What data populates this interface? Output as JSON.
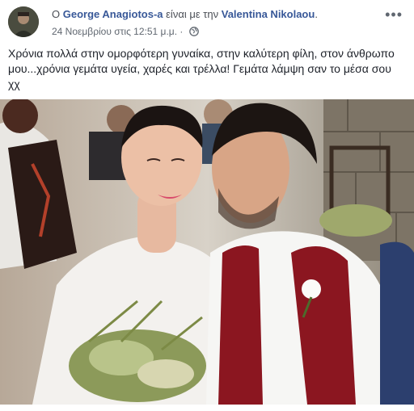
{
  "post": {
    "prefix": "O",
    "author": "George Anagiotos-a",
    "with_text": "είναι με την",
    "tagged": "Valentina Nikolaou",
    "tagged_suffix": ".",
    "timestamp": "24 Νοεμβρίου στις 12:51 μ.μ.",
    "privacy_dot": "·",
    "more_label": "•••",
    "body": "Χρόνια πολλά στην ομορφότερη γυναίκα, στην καλύτερη φίλη, στον άνθρωπο μου...χρόνια γεμάτα υγεία, χαρές και τρέλλα! Γεμάτα λάμψη σαν το μέσα σου χχ"
  },
  "icons": {
    "avatar": "profile-avatar",
    "privacy": "globe-icon",
    "more": "more-options-icon"
  },
  "colors": {
    "link": "#385898",
    "meta": "#606770",
    "text": "#1d2129"
  }
}
